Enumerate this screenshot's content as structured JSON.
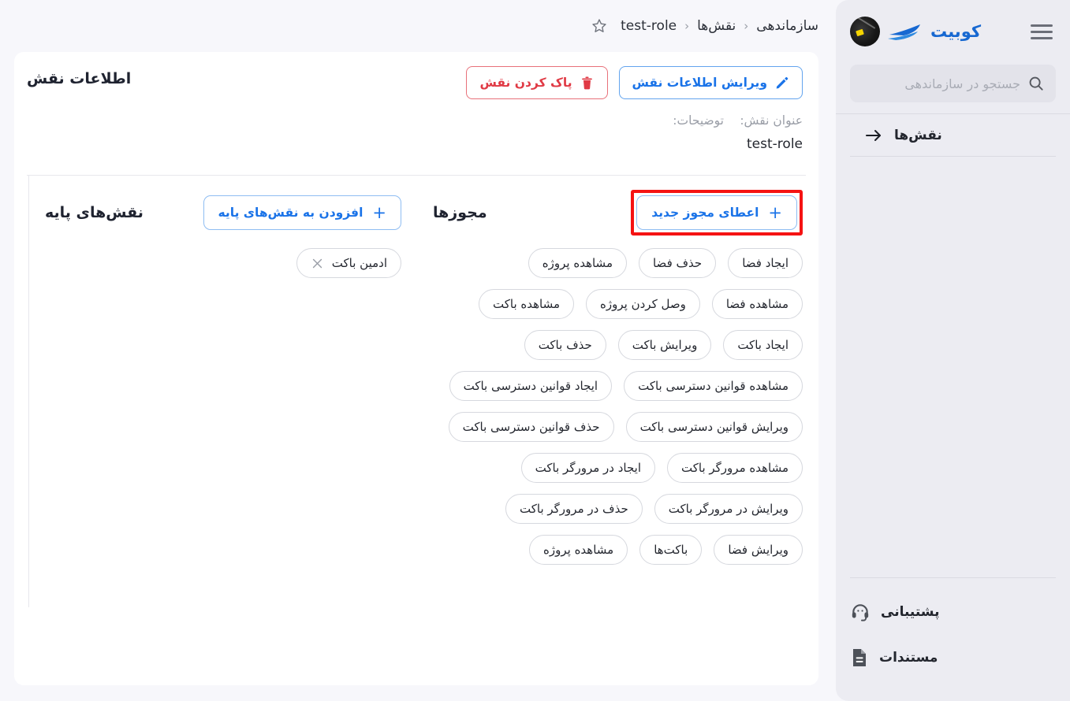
{
  "sidebar": {
    "brand_name": "کوبیت",
    "brand_mark": "boat-logo-icon",
    "menu_icon": "hamburger-menu-icon",
    "avatar_icon": "user-avatar",
    "search": {
      "placeholder": "جستجو در سازماندهی",
      "value": "",
      "icon": "search-icon"
    },
    "nav_items": [
      {
        "label": "نقش‌ها",
        "icon": "arrow-right-icon"
      }
    ],
    "bottom_items": [
      {
        "label": "پشتیبانی",
        "icon": "headset-support-icon"
      },
      {
        "label": "مستندات",
        "icon": "document-icon"
      }
    ]
  },
  "breadcrumb": {
    "items": [
      {
        "label": "سازماندهی"
      },
      {
        "label": "نقش‌ها"
      },
      {
        "label": "test-role"
      }
    ],
    "separator": "‹",
    "star_icon": "star-outline-icon"
  },
  "role_info": {
    "section_title": "اطلاعات نقش",
    "delete_button": {
      "label": "پاک کردن نقش",
      "icon": "trash-icon"
    },
    "edit_button": {
      "label": "ویرایش اطلاعات نقش",
      "icon": "pencil-icon"
    },
    "title_label": "عنوان نقش:",
    "title_value": "test-role",
    "description_label": "توضیحات:",
    "description_value": ""
  },
  "permissions": {
    "section_title": "مجوزها",
    "add_button": {
      "label": "اعطای مجوز جدید",
      "icon": "plus-icon"
    },
    "highlighted": true,
    "highlight_color": "#f51313",
    "chips": [
      "ایجاد فضا",
      "حذف فضا",
      "مشاهده پروژه",
      "مشاهده فضا",
      "وصل کردن پروژه",
      "مشاهده باکت",
      "ایجاد باکت",
      "ویرایش باکت",
      "حذف باکت",
      "مشاهده قوانین دسترسی باکت",
      "ایجاد قوانین دسترسی باکت",
      "ویرایش قوانین دسترسی باکت",
      "حذف قوانین دسترسی باکت",
      "مشاهده مرورگر باکت",
      "ایجاد در مرورگر باکت",
      "ویرایش در مرورگر باکت",
      "حذف در مرورگر باکت",
      "ویرایش فضا",
      "باکت‌ها",
      "مشاهده پروژه"
    ]
  },
  "base_roles": {
    "section_title": "نقش‌های پایه",
    "add_button": {
      "label": "افزودن به نقش‌های پایه",
      "icon": "plus-icon"
    },
    "chips": [
      {
        "label": "ادمین باکت",
        "remove_icon": "close-x-icon"
      }
    ]
  },
  "colors": {
    "accent_blue": "#1a73e8",
    "danger_red": "#e03a45",
    "highlight_red": "#f51313",
    "page_bg": "#f7f7fb",
    "sidebar_bg": "#ececf2",
    "card_bg": "#ffffff"
  }
}
